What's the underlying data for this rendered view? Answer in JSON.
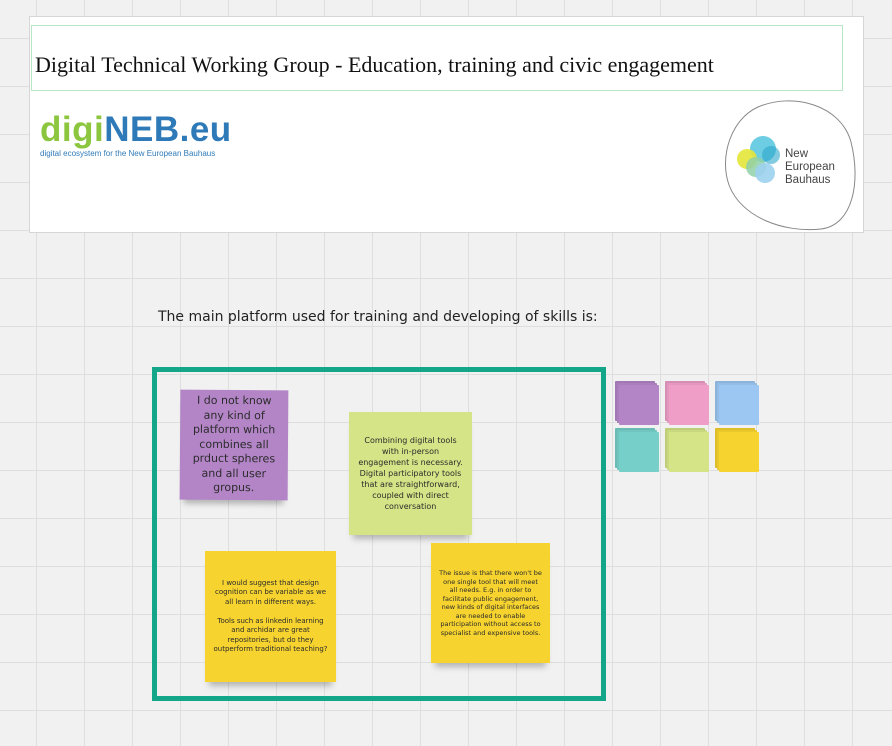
{
  "header": {
    "title": "Digital Technical Working Group - Education, training and civic engagement",
    "logo_left": {
      "wordmark_part1": "digi",
      "wordmark_part2": "NEB.eu",
      "tagline": "digital ecosystem for the New European Bauhaus"
    },
    "logo_right": {
      "line1": "New",
      "line2": "European",
      "line3": "Bauhaus"
    }
  },
  "question": "The main platform used for training and developing of skills is:",
  "notes": [
    {
      "text": "I do not know any kind of platform which combines all prduct spheres and all user gropus.",
      "color": "#b385c7"
    },
    {
      "text": "Combining digital tools with in-person engagement is necessary. Digital participatory tools that are straightforward, coupled with direct conversation",
      "color": "#d4e486"
    },
    {
      "text": "I would suggest that design cognition can be variable as we all learn in different ways.\n\nTools such as linkedin learning and archidar are great repositories, but do they outperform traditional teaching?",
      "color": "#f6d32e"
    },
    {
      "text": "The issue is that there won't be one single tool that will meet all needs. E.g. in order to facilitate public engagement, new kinds of digital interfaces are needed to enable participation without access to specialist and expensive tools.",
      "color": "#f6d32e"
    }
  ],
  "sticky_palette": [
    {
      "name": "purple",
      "color": "#b385c7"
    },
    {
      "name": "pink",
      "color": "#ef9ec8"
    },
    {
      "name": "blue",
      "color": "#9cc7f2"
    },
    {
      "name": "teal",
      "color": "#76cfc9"
    },
    {
      "name": "lime",
      "color": "#d4e486"
    },
    {
      "name": "yellow",
      "color": "#f6d32e"
    }
  ]
}
